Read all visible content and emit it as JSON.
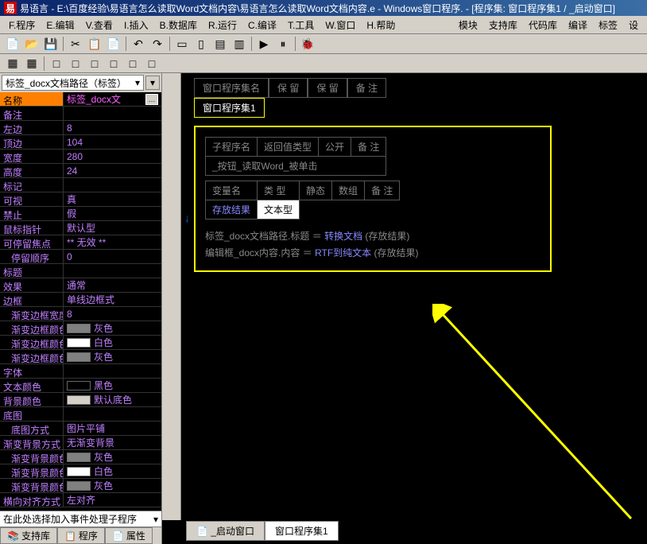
{
  "title": "易语言 - E:\\百度经验\\易语言怎么读取Word文档内容\\易语言怎么读取Word文档内容.e - Windows窗口程序. - [程序集: 窗口程序集1 / _启动窗口]",
  "menu": {
    "program": "F.程序",
    "edit": "E.编辑",
    "search": "V.查看",
    "insert": "I.插入",
    "database": "B.数据库",
    "run": "R.运行",
    "compile": "C.编译",
    "tools": "T.工具",
    "window": "W.窗口",
    "help": "H.帮助",
    "module": "模块",
    "support": "支持库",
    "codebank": "代码库",
    "compile2": "编译",
    "label": "标签",
    "settings": "设"
  },
  "dropdown": {
    "selected": "标签_docx文档路径（标签）"
  },
  "props": {
    "name": {
      "label": "名称",
      "value": "标签_docx文"
    },
    "remark": {
      "label": "备注",
      "value": ""
    },
    "left": {
      "label": "左边",
      "value": "8"
    },
    "top": {
      "label": "顶边",
      "value": "104"
    },
    "width": {
      "label": "宽度",
      "value": "280"
    },
    "height": {
      "label": "高度",
      "value": "24"
    },
    "mark": {
      "label": "标记",
      "value": ""
    },
    "visible": {
      "label": "可视",
      "value": "真"
    },
    "disabled": {
      "label": "禁止",
      "value": "假"
    },
    "mouse": {
      "label": "鼠标指针",
      "value": "默认型"
    },
    "stop": {
      "label": "可停留焦点",
      "value": "** 无效 **"
    },
    "stoporder": {
      "label": "停留顺序",
      "value": "0"
    },
    "title": {
      "label": "标题",
      "value": ""
    },
    "effect": {
      "label": "效果",
      "value": "通常"
    },
    "border": {
      "label": "边框",
      "value": "单线边框式"
    },
    "gradwidth": {
      "label": "渐变边框宽度",
      "value": "8"
    },
    "gradcolor1": {
      "label": "渐变边框颜色",
      "value": "灰色",
      "swatch": "#808080"
    },
    "gradcolor2": {
      "label": "渐变边框颜色",
      "value": "白色",
      "swatch": "#ffffff"
    },
    "gradcolor3": {
      "label": "渐变边框颜色",
      "value": "灰色",
      "swatch": "#808080"
    },
    "font": {
      "label": "字体",
      "value": ""
    },
    "textcolor": {
      "label": "文本颜色",
      "value": "黑色",
      "swatch": "#000000"
    },
    "bgcolor": {
      "label": "背景颜色",
      "value": "默认底色",
      "swatch": "#d4d0c8"
    },
    "bgimage": {
      "label": "底图",
      "value": ""
    },
    "bgstyle": {
      "label": "底图方式",
      "value": "图片平铺"
    },
    "gradbg": {
      "label": "渐变背景方式",
      "value": "无渐变背景"
    },
    "gradbgc1": {
      "label": "渐变背景颜色",
      "value": "灰色",
      "swatch": "#808080"
    },
    "gradbgc2": {
      "label": "渐变背景颜色",
      "value": "白色",
      "swatch": "#ffffff"
    },
    "gradbgc3": {
      "label": "渐变背景颜色",
      "value": "灰色",
      "swatch": "#808080"
    },
    "align": {
      "label": "横向对齐方式",
      "value": "左对齐"
    }
  },
  "footer": "在此处选择加入事件处理子程序",
  "leftTabs": {
    "support": "支持库",
    "program": "程序",
    "property": "属性"
  },
  "editor": {
    "topTabs": {
      "name": "窗口程序集名",
      "keep": "保 留",
      "keep2": "保 留",
      "remark": "备 注",
      "active": "窗口程序集1"
    },
    "procHeader": {
      "name": "子程序名",
      "ret": "返回值类型",
      "public": "公开",
      "remark": "备 注"
    },
    "procName": "_按钮_读取Word_被单击",
    "varHeader": {
      "name": "变量名",
      "type": "类 型",
      "static": "静态",
      "array": "数组",
      "remark": "备 注"
    },
    "varRow": {
      "name": "存放结果",
      "type": "文本型"
    },
    "code1": {
      "lhs": "标签_docx文档路径.标题",
      "eq": "＝",
      "func": "转换文档",
      "args": "(存放结果)"
    },
    "code2": {
      "lhs": "编辑框_docx内容.内容",
      "eq": "＝",
      "func": "RTF到纯文本",
      "args": "(存放结果)"
    },
    "bottomTabs": {
      "start": "_启动窗口",
      "winset": "窗口程序集1"
    }
  }
}
